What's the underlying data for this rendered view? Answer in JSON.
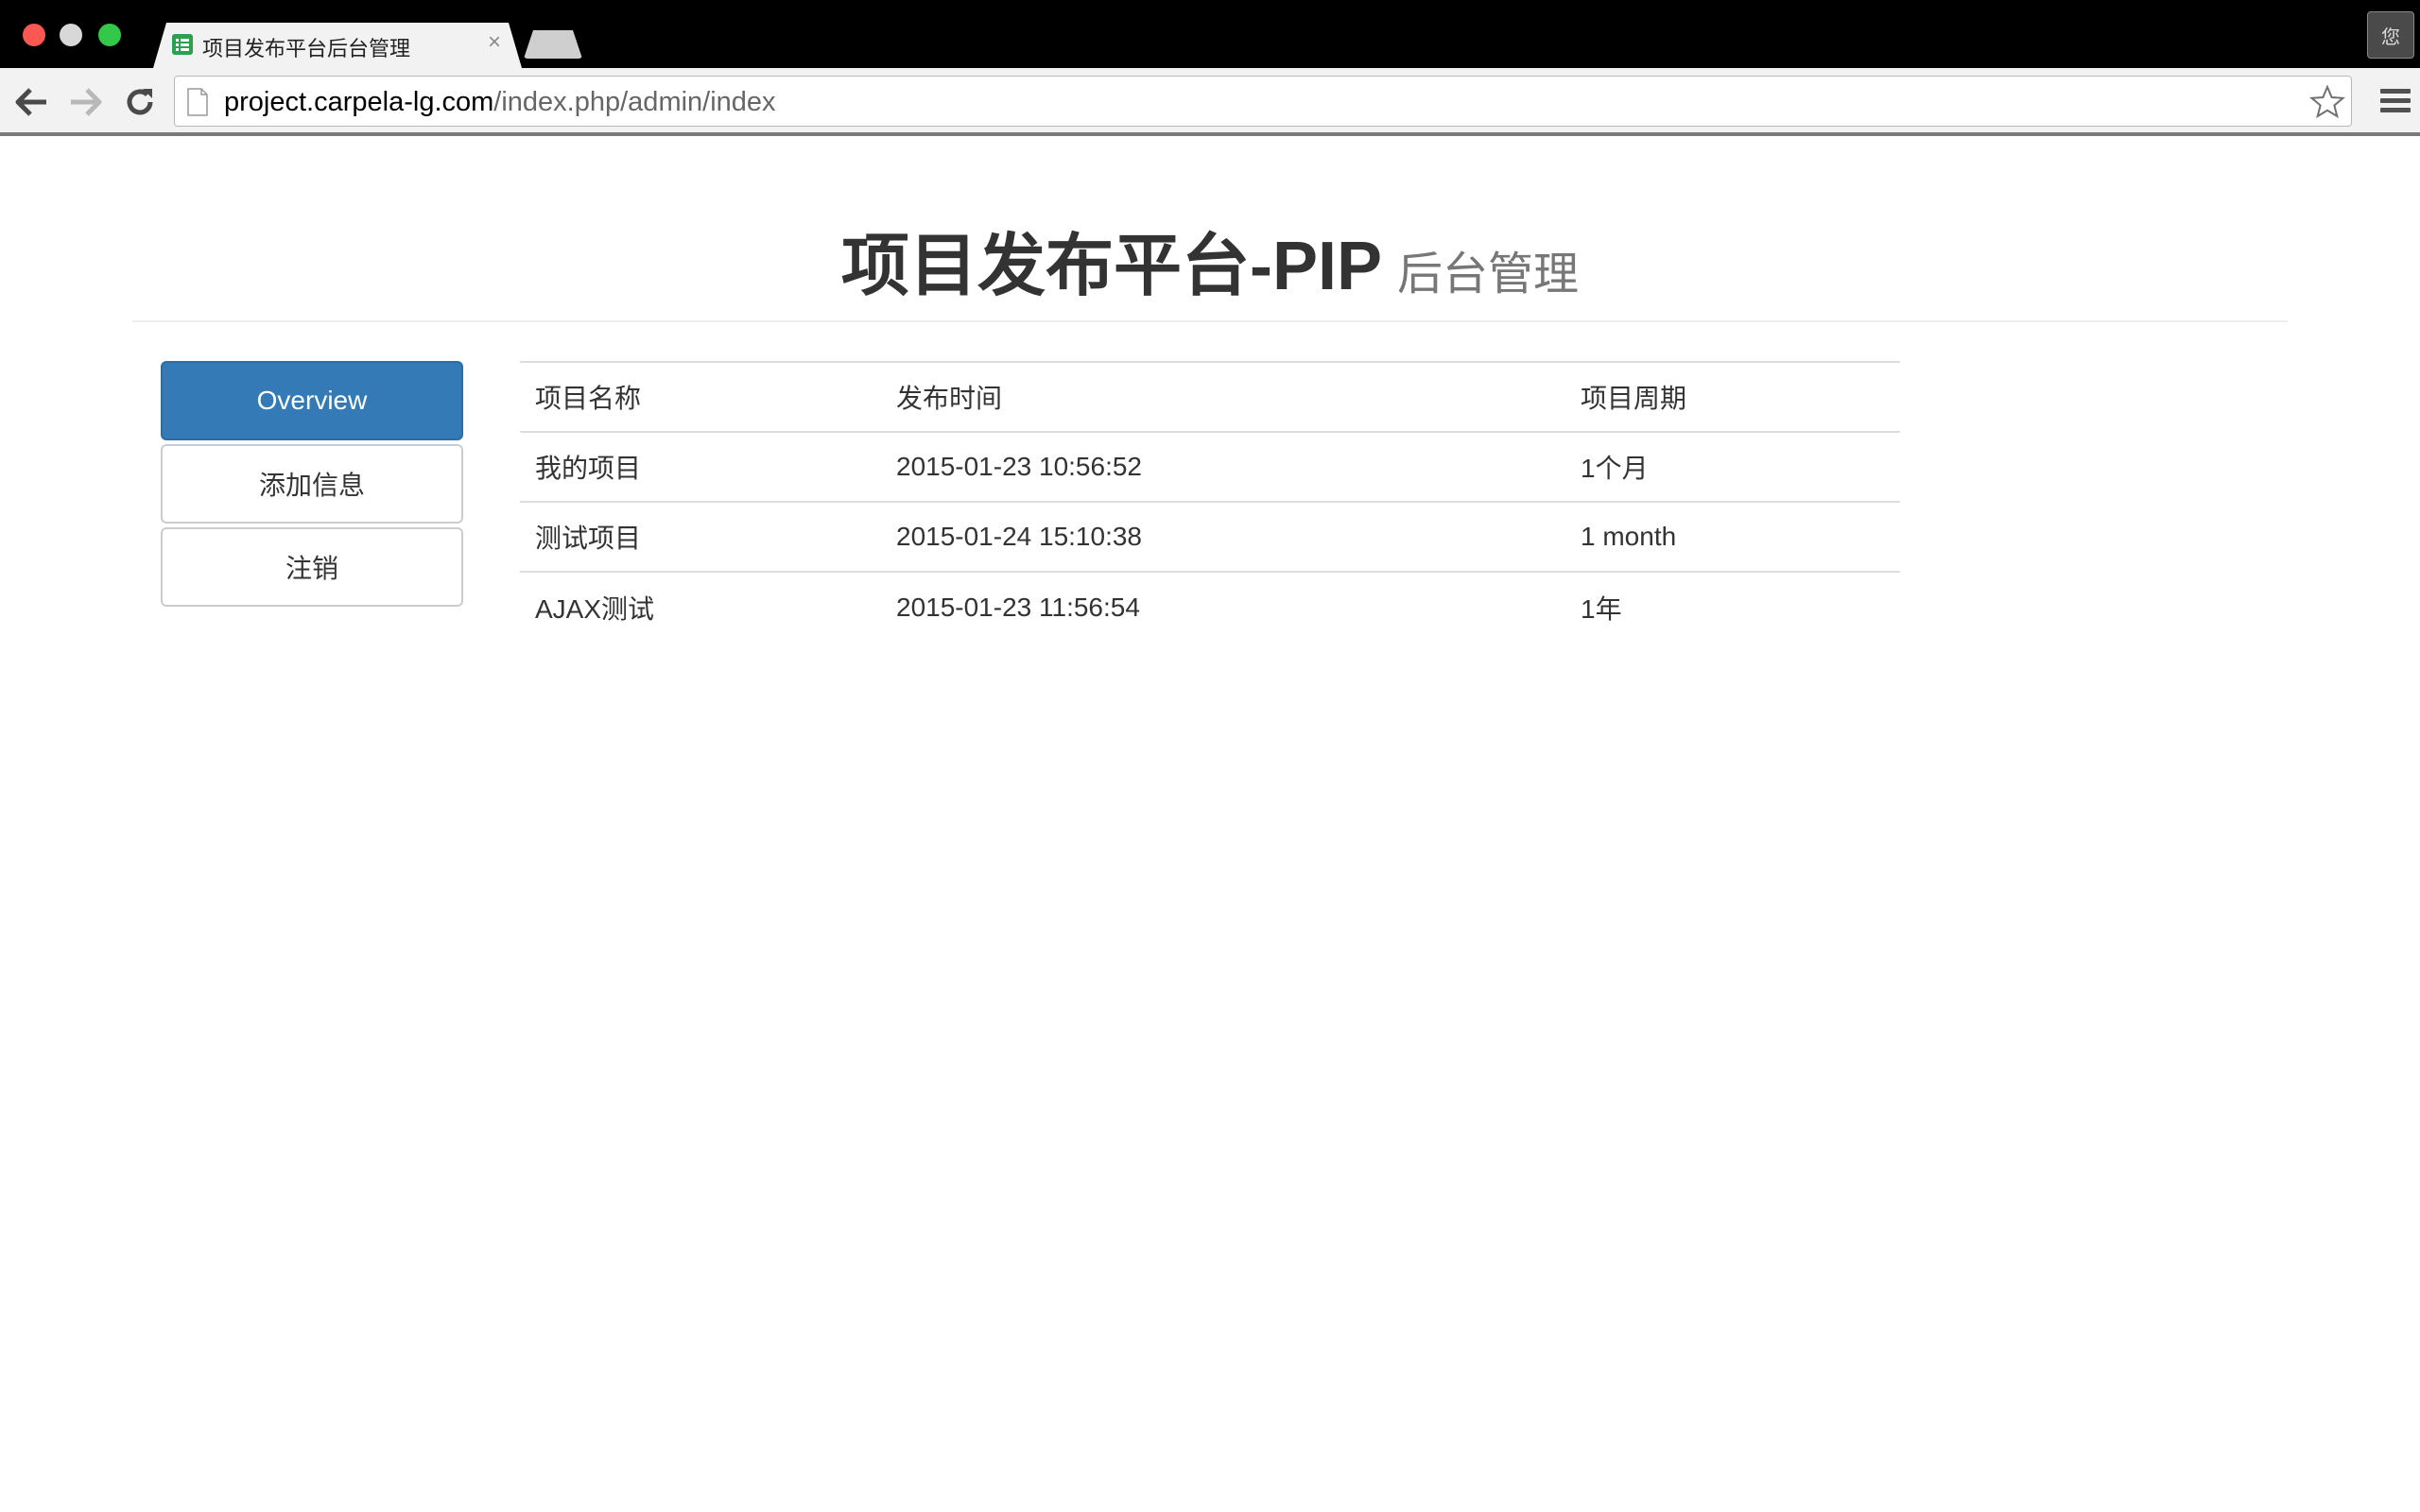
{
  "browser": {
    "tab_title": "项目发布平台后台管理",
    "tab_close": "×",
    "profile_label": "您",
    "url_host": "project.carpela-lg.com",
    "url_path": "/index.php/admin/index"
  },
  "header": {
    "title": "项目发布平台-PIP",
    "subtitle": "后台管理"
  },
  "sidebar": {
    "items": [
      {
        "label": "Overview",
        "active": true
      },
      {
        "label": "添加信息",
        "active": false
      },
      {
        "label": "注销",
        "active": false
      }
    ]
  },
  "table": {
    "headers": [
      "项目名称",
      "发布时间",
      "项目周期"
    ],
    "rows": [
      [
        "我的项目",
        "2015-01-23 10:56:52",
        "1个月"
      ],
      [
        "测试项目",
        "2015-01-24 15:10:38",
        "1 month"
      ],
      [
        "AJAX测试",
        "2015-01-23 11:56:54",
        "1年"
      ]
    ]
  },
  "colors": {
    "accent": "#337ab7",
    "favicon": "#2e9e4f"
  }
}
